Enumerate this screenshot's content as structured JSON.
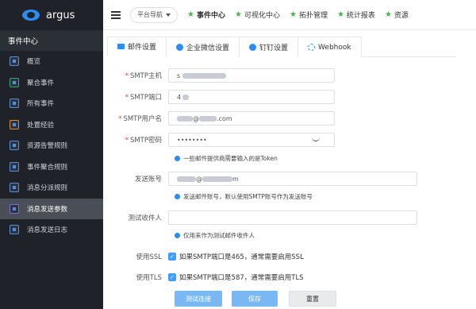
{
  "app": {
    "name": "argus"
  },
  "sidebar": {
    "header": "事件中心",
    "items": [
      {
        "label": "概览"
      },
      {
        "label": "聚合事件"
      },
      {
        "label": "所有事件"
      },
      {
        "label": "处置经验"
      },
      {
        "label": "资源告警规则"
      },
      {
        "label": "事件聚合规则"
      },
      {
        "label": "消息分派规则"
      },
      {
        "label": "消息发送参数"
      },
      {
        "label": "消息发送日志"
      }
    ]
  },
  "topbar": {
    "nav_select": "平台导航",
    "tabs": [
      {
        "label": "事件中心"
      },
      {
        "label": "可视化中心"
      },
      {
        "label": "拓扑管理"
      },
      {
        "label": "统计报表"
      },
      {
        "label": "资源"
      }
    ]
  },
  "tabs": [
    {
      "label": "邮件设置"
    },
    {
      "label": "企业微信设置"
    },
    {
      "label": "钉钉设置"
    },
    {
      "label": "Webhook"
    }
  ],
  "form": {
    "smtp_host": {
      "label": "SMTP主机",
      "value": "s"
    },
    "smtp_port": {
      "label": "SMTP端口",
      "value": "4"
    },
    "smtp_user": {
      "label": "SMTP用户名",
      "value_prefix": "@",
      "value_suffix": ".com"
    },
    "smtp_password": {
      "label": "SMTP密码",
      "value": "••••••••",
      "hint": "一些邮件提供商需要输入的是Token"
    },
    "sender": {
      "label": "发送账号",
      "value_prefix": "@",
      "value_suffix": "m",
      "hint": "发送邮件账号，默认使用SMTP账号作为发送账号"
    },
    "test_receiver": {
      "label": "测试收件人",
      "value": "",
      "hint": "仅用来作为测试邮件收件人"
    },
    "use_ssl": {
      "label": "使用SSL",
      "text": "如果SMTP端口是465，通常需要启用SSL"
    },
    "use_tls": {
      "label": "使用TLS",
      "text": "如果SMTP端口是587，通常需要启用TLS"
    }
  },
  "buttons": {
    "test": "测试连接",
    "save": "保存",
    "reset": "重置"
  },
  "colors": {
    "sidebar_bg": "#1f2329",
    "primary": "#409eff",
    "required": "#e03c3c"
  }
}
